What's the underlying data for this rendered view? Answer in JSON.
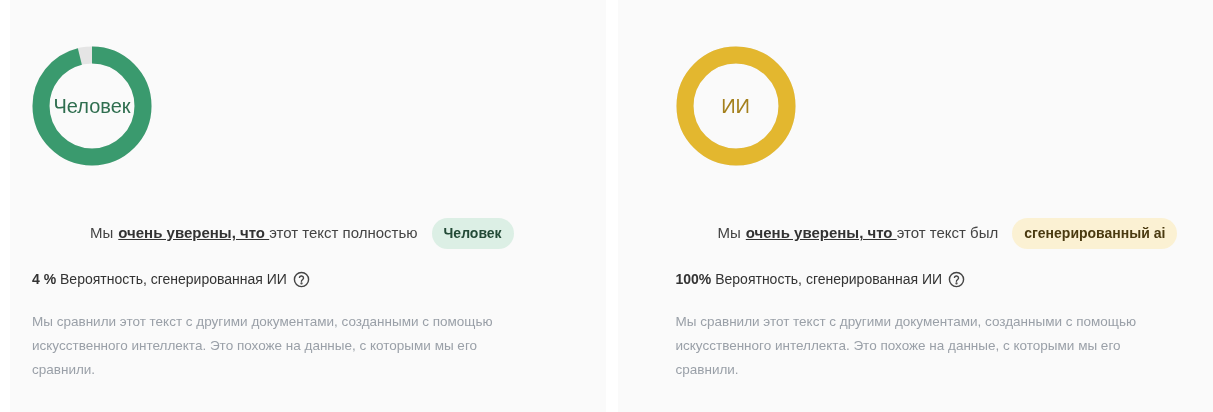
{
  "panels": [
    {
      "kind": "human",
      "color": "#3a9a6e",
      "ring_label": "Человек",
      "level": 0.96,
      "sentence_start": "Мы",
      "sentence_link": "очень уверены, что ",
      "sentence_end": "этот текст полностью",
      "badge": "Человек",
      "probability": "**4 %** Вероятность, сгенерированная ИИ",
      "description": "Мы сравнили этот текст с другими документами, созданными с помощью искусственного интеллекта. Это похоже на данные, с которыми мы его сравнили."
    },
    {
      "kind": "ai",
      "color": "#e3b72f",
      "ring_label": "ИИ",
      "level": 1,
      "sentence_start": "Мы",
      "sentence_link": "очень уверены, что ",
      "sentence_end": "этот текст был",
      "badge": "сгенерированный ai",
      "probability": "**100%** Вероятность, сгенерированная ИИ",
      "description": "Мы сравнили этот текст с другими документами, созданными с помощью искусственного интеллекта. Это похоже на данные, с которыми мы его сравнили."
    }
  ]
}
